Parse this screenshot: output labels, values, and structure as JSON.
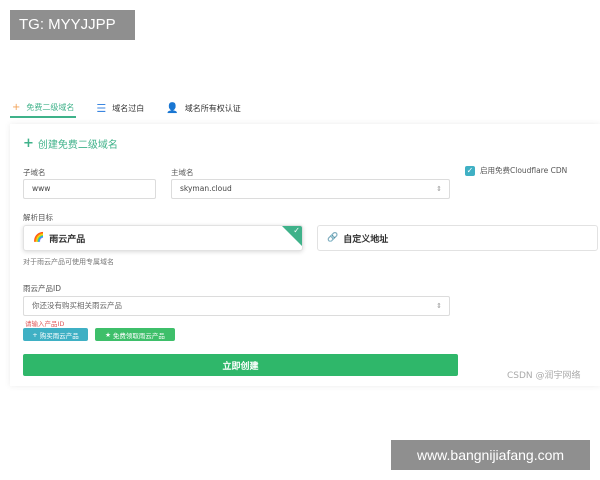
{
  "overlay": {
    "tg": "TG: MYYJJPP",
    "site": "www.bangnijiafang.com",
    "csdn": "CSDN @润宇网络"
  },
  "tabs": [
    {
      "label": "免费二级域名",
      "icon": "plus-icon"
    },
    {
      "label": "域名过白",
      "icon": "list-icon"
    },
    {
      "label": "域名所有权认证",
      "icon": "user-icon"
    }
  ],
  "form": {
    "title": "创建免费二级域名",
    "subdomain": {
      "label": "子域名",
      "value": "www"
    },
    "main_domain": {
      "label": "主域名",
      "value": "skyman.cloud"
    },
    "cdn": {
      "label": "启用免费Cloudflare CDN",
      "checked": true
    },
    "target": {
      "label": "解析目标",
      "options": [
        {
          "label": "雨云产品",
          "selected": true
        },
        {
          "label": "自定义地址",
          "selected": false
        }
      ],
      "hint": "对于雨云产品可使用专属域名"
    },
    "product": {
      "label": "雨云产品ID",
      "placeholder": "你还没有购买相关雨云产品",
      "error": "请输入产品ID",
      "buy_label": "购买雨云产品",
      "free_label": "免费领取雨云产品"
    },
    "submit": "立即创建"
  },
  "colors": {
    "accent": "#3fb28a",
    "primary_button": "#2fb76a",
    "info_button": "#3fb0c4",
    "success_button": "#3ebf6a",
    "error": "#e05a5a"
  }
}
